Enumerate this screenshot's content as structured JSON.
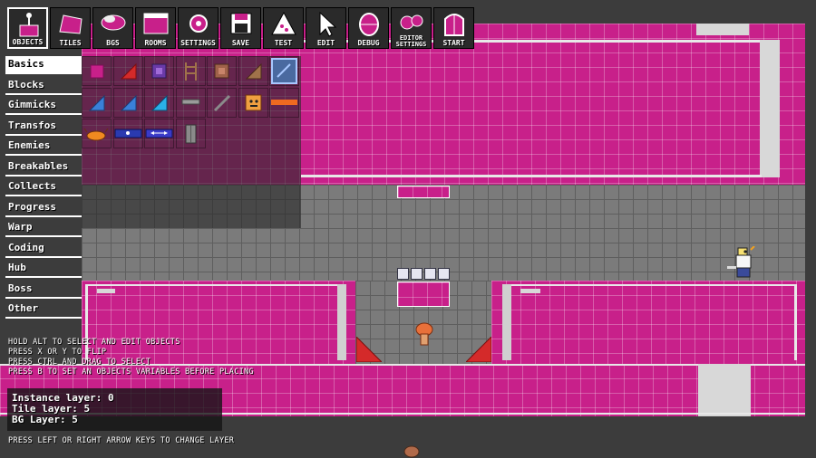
{
  "toolbar": [
    {
      "id": "objects",
      "label": "OBJECTS",
      "icon": "objects-icon",
      "active": true
    },
    {
      "id": "tiles",
      "label": "TILES",
      "icon": "tiles-icon",
      "active": false
    },
    {
      "id": "bgs",
      "label": "BGS",
      "icon": "backgrounds-icon",
      "active": false
    },
    {
      "id": "rooms",
      "label": "ROOMS",
      "icon": "rooms-icon",
      "active": false
    },
    {
      "id": "settings",
      "label": "SETTINGS",
      "icon": "settings-icon",
      "active": false
    },
    {
      "id": "save",
      "label": "SAVE",
      "icon": "save-icon",
      "active": false
    },
    {
      "id": "test",
      "label": "TEST",
      "icon": "test-icon",
      "active": false
    },
    {
      "id": "edit",
      "label": "EDIT",
      "icon": "edit-cursor-icon",
      "active": false
    },
    {
      "id": "debug",
      "label": "DEBUG",
      "icon": "debug-icon",
      "active": false
    },
    {
      "id": "editor-settings",
      "label": "EDITOR SETTINGS",
      "icon": "editor-settings-icon",
      "active": false
    },
    {
      "id": "start",
      "label": "START",
      "icon": "door-icon",
      "active": false
    }
  ],
  "categories": [
    {
      "label": "Basics",
      "selected": true
    },
    {
      "label": "Blocks",
      "selected": false
    },
    {
      "label": "Gimmicks",
      "selected": false
    },
    {
      "label": "Transfos",
      "selected": false
    },
    {
      "label": "Enemies",
      "selected": false
    },
    {
      "label": "Breakables",
      "selected": false
    },
    {
      "label": "Collects",
      "selected": false
    },
    {
      "label": "Progress",
      "selected": false
    },
    {
      "label": "Warp",
      "selected": false
    },
    {
      "label": "Coding",
      "selected": false
    },
    {
      "label": "Hub",
      "selected": false
    },
    {
      "label": "Boss",
      "selected": false
    },
    {
      "label": "Other",
      "selected": false
    }
  ],
  "palette": [
    {
      "name": "solid-block",
      "icon": "pink-square-icon"
    },
    {
      "name": "slope-block",
      "icon": "red-slope-icon"
    },
    {
      "name": "secret-block",
      "icon": "purple-block-icon"
    },
    {
      "name": "ladder",
      "icon": "ladder-icon"
    },
    {
      "name": "destroyable-block",
      "icon": "brown-block-icon"
    },
    {
      "name": "brown-slope",
      "icon": "brown-slope-icon"
    },
    {
      "name": "selected-tool",
      "icon": "blue-frame-icon"
    },
    {
      "name": "blue-slope-small",
      "icon": "blue-slope-icon"
    },
    {
      "name": "blue-slope-medium",
      "icon": "blue-slope-icon"
    },
    {
      "name": "cyan-slope",
      "icon": "cyan-slope-icon"
    },
    {
      "name": "platform",
      "icon": "gray-platform-icon"
    },
    {
      "name": "diagonal-rail",
      "icon": "rail-icon"
    },
    {
      "name": "orange-face-block",
      "icon": "face-block-icon"
    },
    {
      "name": "orange-bar",
      "icon": "orange-bar-icon"
    },
    {
      "name": "spike-enemy",
      "icon": "orange-creature-icon"
    },
    {
      "name": "conveyor",
      "icon": "conveyor-icon"
    },
    {
      "name": "arrow-conveyor",
      "icon": "arrow-conveyor-icon"
    },
    {
      "name": "door",
      "icon": "gray-door-icon"
    }
  ],
  "help": {
    "line1": "HOLD ALT TO SELECT AND EDIT OBJECTS",
    "line2": "PRESS X OR Y TO FLIP",
    "line3": "PRESS CTRL AND DRAG TO SELECT",
    "line4": "PRESS B TO SET AN OBJECTS VARIABLES BEFORE PLACING",
    "footer": "PRESS LEFT OR RIGHT ARROW KEYS TO CHANGE LAYER"
  },
  "layers": {
    "instance": "Instance layer: 0",
    "tile": "Tile layer: 5",
    "bg": "BG Layer: 5"
  },
  "colors": {
    "pink": "#c8208a",
    "gray": "#7b7b7b",
    "accent_red": "#d42a2a",
    "orange": "#f06a20"
  }
}
